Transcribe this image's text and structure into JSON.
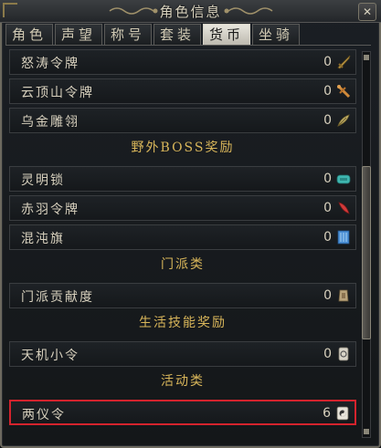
{
  "window": {
    "title": "角色信息",
    "close_label": "✕"
  },
  "tabs": [
    {
      "label": "角色",
      "active": false
    },
    {
      "label": "声望",
      "active": false
    },
    {
      "label": "称号",
      "active": false
    },
    {
      "label": "套装",
      "active": false
    },
    {
      "label": "货币",
      "active": true
    },
    {
      "label": "坐骑",
      "active": false
    }
  ],
  "rows": {
    "r1": {
      "name": "怒涛令牌",
      "value": "0",
      "icon": "dagger-icon",
      "color": "#c9a34a"
    },
    "r2": {
      "name": "云顶山令牌",
      "value": "0",
      "icon": "dagger-icon",
      "color": "#d08a3a"
    },
    "r3": {
      "name": "乌金雕翎",
      "value": "0",
      "icon": "feather-icon",
      "color": "#c8b870"
    },
    "h1": {
      "label": "野外BOSS奖励"
    },
    "r4": {
      "name": "灵明锁",
      "value": "0",
      "icon": "lock-icon",
      "color": "#3fb6b0"
    },
    "r5": {
      "name": "赤羽令牌",
      "value": "0",
      "icon": "red-feather-icon",
      "color": "#d23a3a"
    },
    "r6": {
      "name": "混沌旗",
      "value": "0",
      "icon": "flag-icon",
      "color": "#4a8fd6"
    },
    "h2": {
      "label": "门派类"
    },
    "r7": {
      "name": "门派贡献度",
      "value": "0",
      "icon": "badge-icon",
      "color": "#b8a27a"
    },
    "h3": {
      "label": "生活技能奖励"
    },
    "r8": {
      "name": "天机小令",
      "value": "0",
      "icon": "token-icon",
      "color": "#d8d4c8"
    },
    "h4": {
      "label": "活动类"
    },
    "r9": {
      "name": "两仪令",
      "value": "6",
      "icon": "yinyang-token-icon",
      "color": "#e8e4da",
      "highlighted": true
    }
  }
}
